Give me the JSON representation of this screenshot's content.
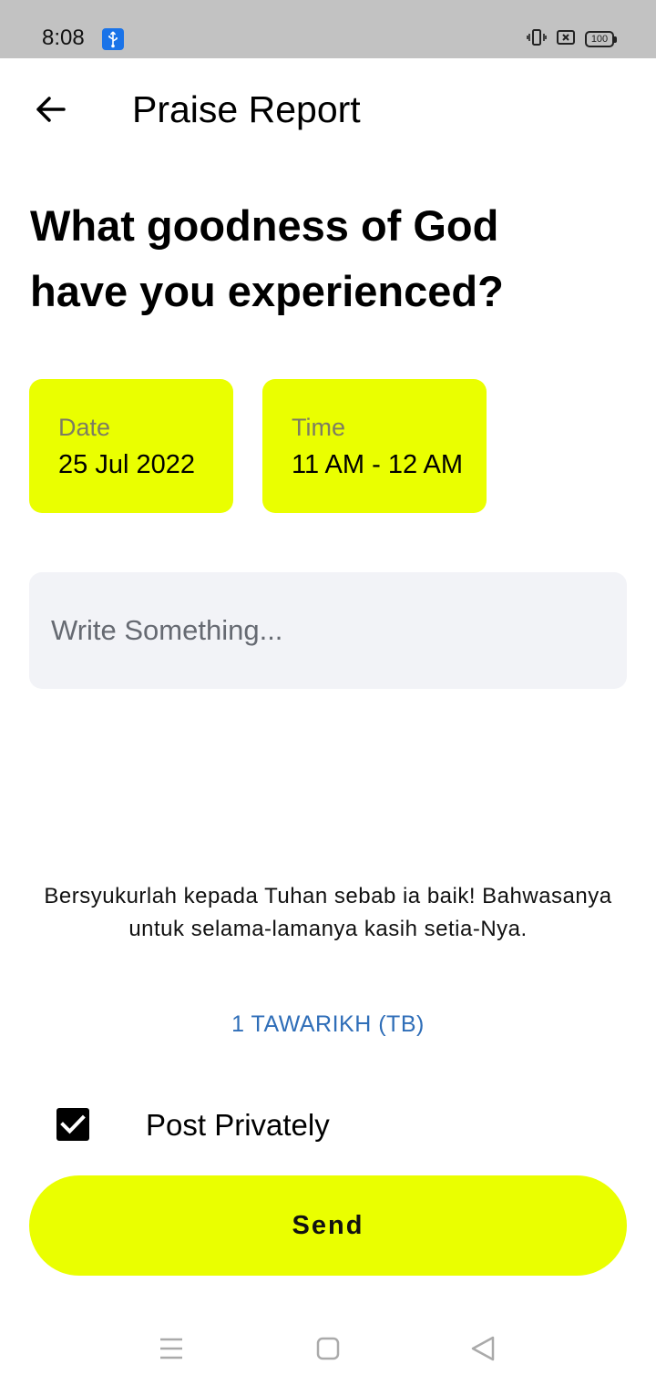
{
  "status_bar": {
    "time": "8:08",
    "battery": "100",
    "icons": [
      "usb-icon",
      "vibrate-icon",
      "no-sim-icon",
      "battery-icon"
    ]
  },
  "header": {
    "title": "Praise Report",
    "back_icon": "arrow-left-icon"
  },
  "headline": {
    "line1": "What goodness of God",
    "line2": "have you experienced?"
  },
  "date_picker": {
    "label": "Date",
    "value": "25 Jul 2022"
  },
  "time_picker": {
    "label": "Time",
    "value": "11 AM - 12 AM"
  },
  "message": {
    "placeholder": "Write Something..."
  },
  "verse": {
    "text": "Bersyukurlah kepada Tuhan sebab ia baik! Bahwasanya untuk selama-lamanya kasih setia-Nya.",
    "reference": "1 TAWARIKH (TB)"
  },
  "privacy": {
    "label": "Post Privately",
    "checked": true
  },
  "send_button": {
    "label": "Send"
  },
  "colors": {
    "accent": "#eaff00",
    "link": "#2f6eb8",
    "input_bg": "#f2f3f7",
    "status_bar": "#c2c2c2"
  },
  "nav": {
    "icons": [
      "menu-icon",
      "home-square-icon",
      "back-triangle-icon"
    ]
  }
}
